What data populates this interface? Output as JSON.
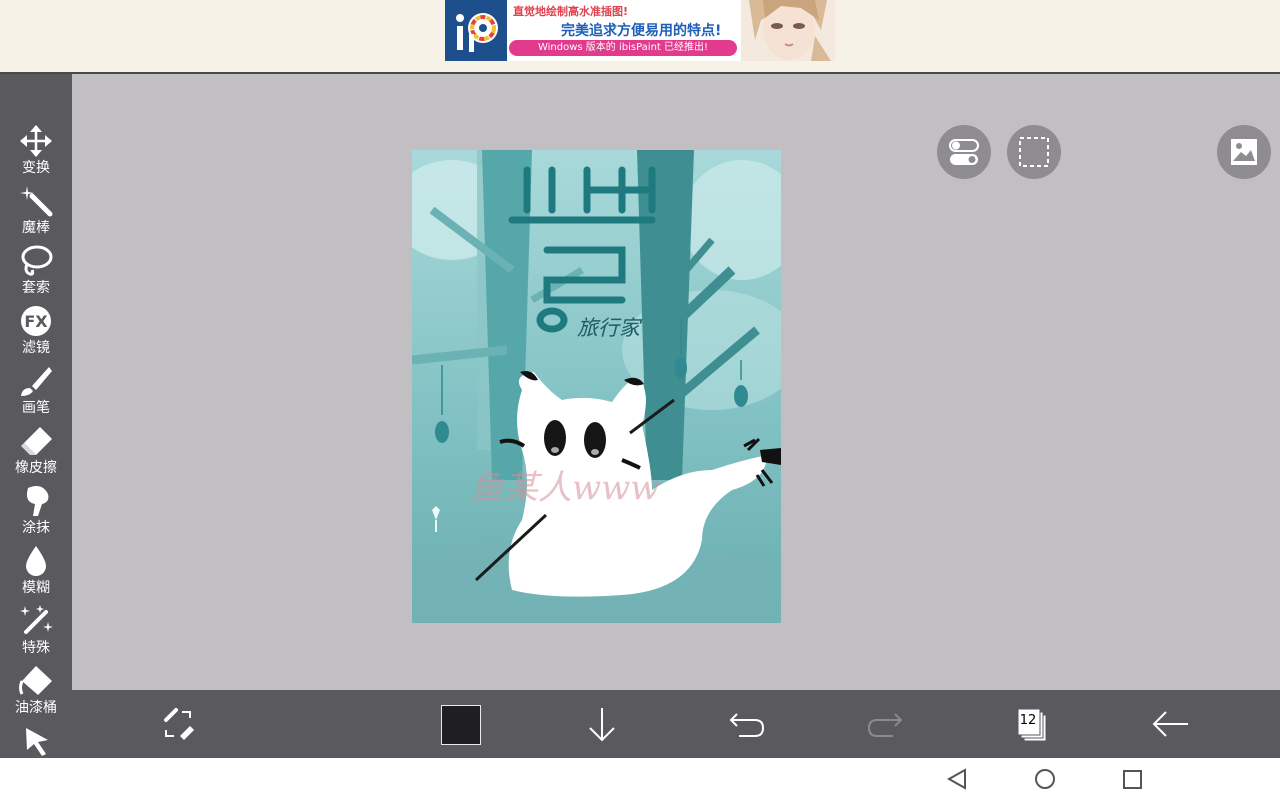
{
  "ad": {
    "line1": "直觉地绘制高水准插图!",
    "line2": "完美追求方便易用的特点!",
    "line3": "Windows 版本的 ibisPaint 已经推出!"
  },
  "tools": [
    {
      "label": "变换",
      "icon": "move-arrows-icon"
    },
    {
      "label": "魔棒",
      "icon": "magic-wand-icon"
    },
    {
      "label": "套索",
      "icon": "lasso-icon"
    },
    {
      "label": "滤镜",
      "icon": "fx-icon",
      "icon_text": "FX"
    },
    {
      "label": "画笔",
      "icon": "brush-icon"
    },
    {
      "label": "橡皮擦",
      "icon": "eraser-icon"
    },
    {
      "label": "涂抹",
      "icon": "smudge-icon"
    },
    {
      "label": "模糊",
      "icon": "blur-drop-icon"
    },
    {
      "label": "特殊",
      "icon": "special-pen-icon"
    },
    {
      "label": "油漆桶",
      "icon": "paint-bucket-icon"
    }
  ],
  "canvas": {
    "title_text": "旅行家",
    "watermark_text": "鱼某人www"
  },
  "bottom_bar": {
    "current_color": "#1f1e22",
    "layer_count": "12"
  },
  "colors": {
    "toolbar_bg": "#5a595e",
    "workspace_bg": "#c1bfc2",
    "canvas_teal": "#6fb7b9"
  }
}
